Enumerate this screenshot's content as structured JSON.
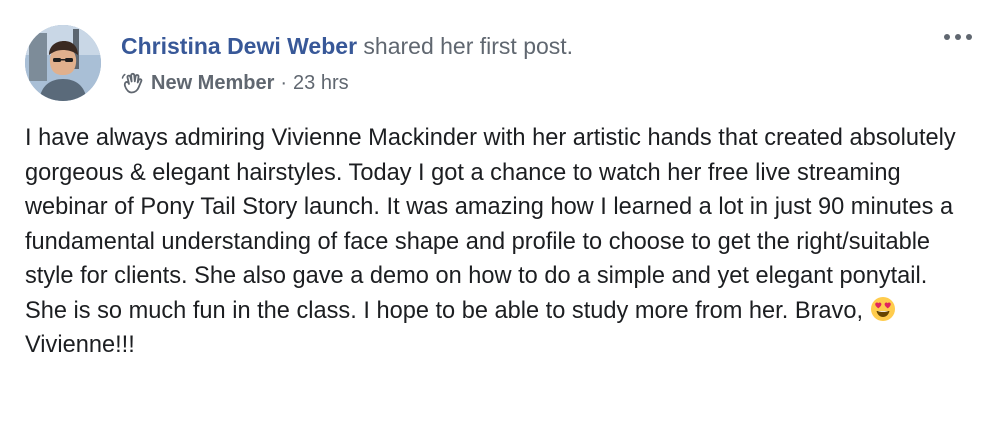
{
  "post": {
    "author": "Christina Dewi Weber",
    "action": "shared her first post.",
    "badge": "New Member",
    "separator": "·",
    "timestamp": "23 hrs",
    "badge_icon": "waving-hand-icon",
    "more_icon": "more-options-icon",
    "text_before_emoji": "I have always admiring Vivienne Mackinder with her artistic hands that created absolutely gorgeous & elegant hairstyles. Today I got a chance to watch her free live streaming webinar of Pony Tail Story launch. It was amazing how I learned a lot in just 90 minutes a fundamental understanding of face shape and profile to choose to get the right/suitable style for clients. She also gave a demo on how to do a simple and yet elegant ponytail. She is so much fun in the class. I hope to be able to study more from her. Bravo, ",
    "emoji": "heart-eyes-emoji",
    "text_after_emoji": "Vivienne!!!"
  },
  "colors": {
    "author": "#385898",
    "secondary": "#606770",
    "text": "#1c1e21",
    "emoji_face": "#ffcc4d",
    "emoji_heart": "#e0245e"
  }
}
